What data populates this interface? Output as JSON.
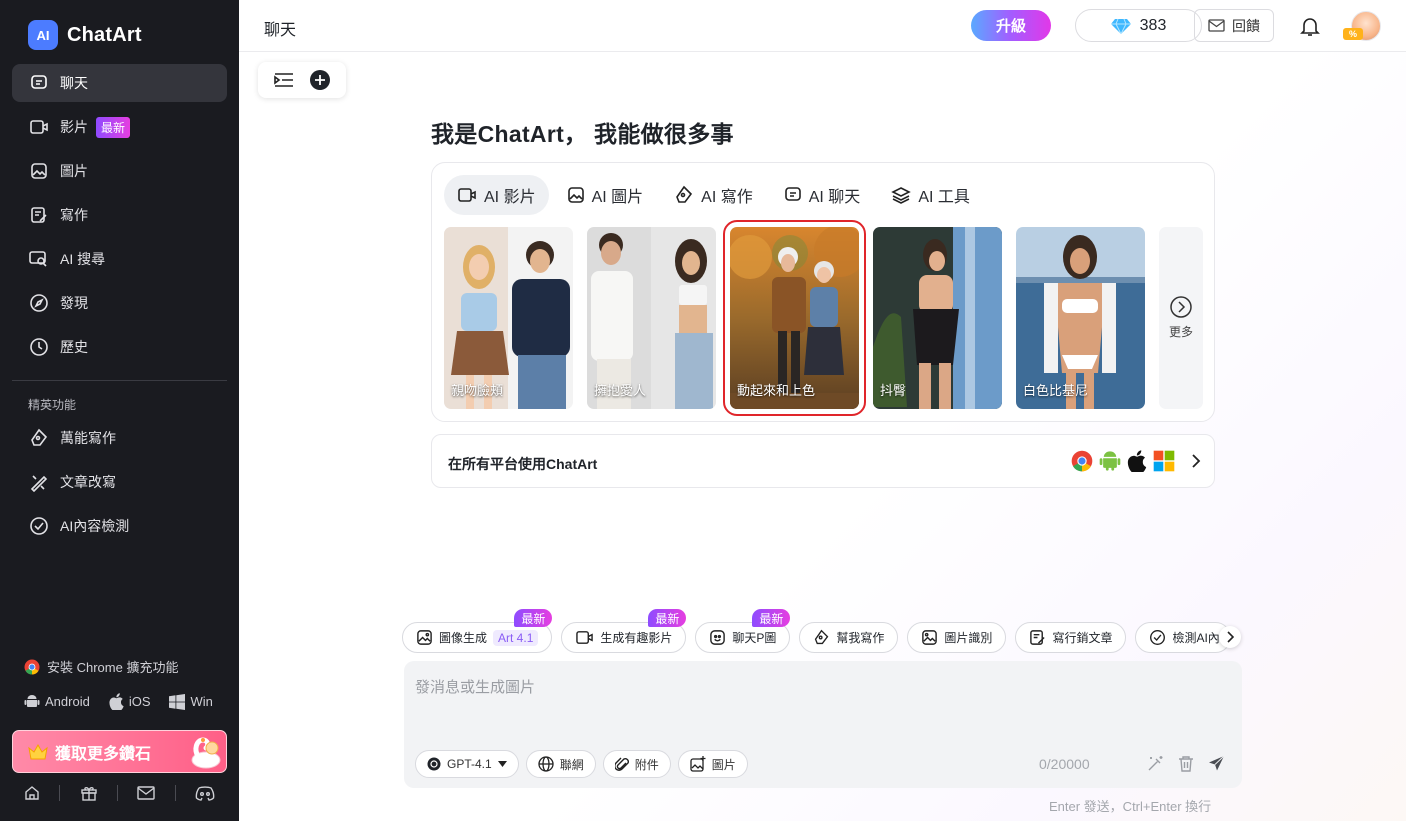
{
  "app": {
    "name": "ChatArt",
    "logo_mark": "AI"
  },
  "sidebar": {
    "items": [
      {
        "label": "聊天",
        "icon": "chat-icon",
        "active": true
      },
      {
        "label": "影片",
        "icon": "video-icon",
        "badge": "最新"
      },
      {
        "label": "圖片",
        "icon": "image-icon"
      },
      {
        "label": "寫作",
        "icon": "write-icon"
      },
      {
        "label": "AI 搜尋",
        "icon": "ai-search-icon"
      },
      {
        "label": "發現",
        "icon": "compass-icon"
      },
      {
        "label": "歷史",
        "icon": "history-icon"
      }
    ],
    "section_title": "精英功能",
    "premium_items": [
      {
        "label": "萬能寫作",
        "icon": "pen-icon"
      },
      {
        "label": "文章改寫",
        "icon": "rewrite-icon"
      },
      {
        "label": "AI內容檢測",
        "icon": "check-circle-icon"
      }
    ],
    "chrome_ext": "安裝 Chrome 擴充功能",
    "platforms": [
      "Android",
      "iOS",
      "Win"
    ],
    "get_diamonds": "獲取更多鑽石"
  },
  "header": {
    "title": "聊天",
    "upgrade": "升級",
    "diamonds": "383",
    "feedback": "回饋"
  },
  "main": {
    "headline": "我是ChatArt， 我能做很多事",
    "tabs": [
      {
        "label": "AI 影片",
        "icon": "video-icon",
        "active": true
      },
      {
        "label": "AI 圖片",
        "icon": "image-icon"
      },
      {
        "label": "AI 寫作",
        "icon": "pen-icon"
      },
      {
        "label": "AI 聊天",
        "icon": "chat-icon"
      },
      {
        "label": "AI 工具",
        "icon": "layers-icon"
      }
    ],
    "cards": [
      {
        "label": "親吻臉頰"
      },
      {
        "label": "擁抱愛人"
      },
      {
        "label": "動起來和上色",
        "selected": true
      },
      {
        "label": "抖臀"
      },
      {
        "label": "白色比基尼"
      }
    ],
    "more": "更多",
    "platform_bar": "在所有平台使用ChatArt"
  },
  "composer": {
    "chips": [
      {
        "label": "圖像生成",
        "icon": "image-gen-icon",
        "tag": "Art 4.1",
        "badge": "最新"
      },
      {
        "label": "生成有趣影片",
        "icon": "video-icon",
        "badge": "最新"
      },
      {
        "label": "聊天P圖",
        "icon": "image-edit-icon",
        "badge": "最新"
      },
      {
        "label": "幫我寫作",
        "icon": "pen-icon"
      },
      {
        "label": "圖片識別",
        "icon": "image-scan-icon"
      },
      {
        "label": "寫行銷文章",
        "icon": "article-icon"
      },
      {
        "label": "檢測AI內",
        "icon": "check-circle-icon"
      }
    ],
    "placeholder": "發消息或生成圖片",
    "model": "GPT-4.1",
    "tools": [
      "聯網",
      "附件",
      "圖片"
    ],
    "counter": "0/20000",
    "hint": "Enter 發送，Ctrl+Enter 換行"
  },
  "colors": {
    "accent": "#4c7cff",
    "sidebar_bg": "#1a1b20",
    "badge": "#c040ee",
    "selection": "#e0252a"
  }
}
